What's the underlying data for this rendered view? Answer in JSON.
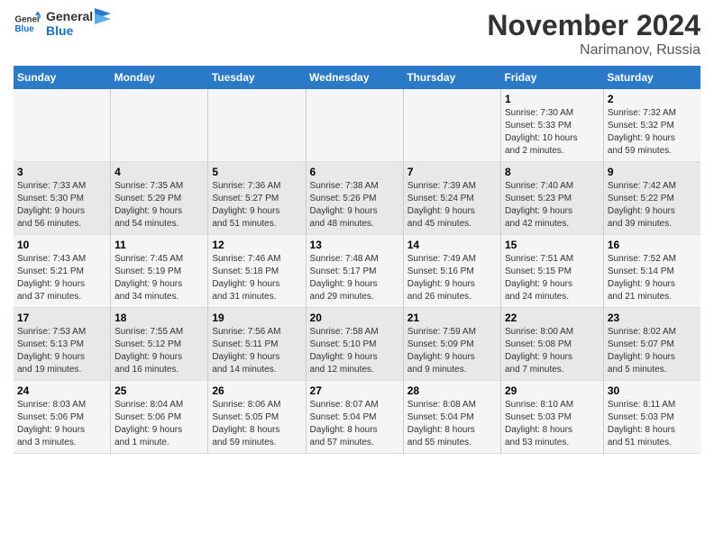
{
  "header": {
    "logo_general": "General",
    "logo_blue": "Blue",
    "title": "November 2024",
    "subtitle": "Narimanov, Russia"
  },
  "days_of_week": [
    "Sunday",
    "Monday",
    "Tuesday",
    "Wednesday",
    "Thursday",
    "Friday",
    "Saturday"
  ],
  "weeks": [
    {
      "days": [
        {
          "num": "",
          "info": ""
        },
        {
          "num": "",
          "info": ""
        },
        {
          "num": "",
          "info": ""
        },
        {
          "num": "",
          "info": ""
        },
        {
          "num": "",
          "info": ""
        },
        {
          "num": "1",
          "info": "Sunrise: 7:30 AM\nSunset: 5:33 PM\nDaylight: 10 hours\nand 2 minutes."
        },
        {
          "num": "2",
          "info": "Sunrise: 7:32 AM\nSunset: 5:32 PM\nDaylight: 9 hours\nand 59 minutes."
        }
      ]
    },
    {
      "days": [
        {
          "num": "3",
          "info": "Sunrise: 7:33 AM\nSunset: 5:30 PM\nDaylight: 9 hours\nand 56 minutes."
        },
        {
          "num": "4",
          "info": "Sunrise: 7:35 AM\nSunset: 5:29 PM\nDaylight: 9 hours\nand 54 minutes."
        },
        {
          "num": "5",
          "info": "Sunrise: 7:36 AM\nSunset: 5:27 PM\nDaylight: 9 hours\nand 51 minutes."
        },
        {
          "num": "6",
          "info": "Sunrise: 7:38 AM\nSunset: 5:26 PM\nDaylight: 9 hours\nand 48 minutes."
        },
        {
          "num": "7",
          "info": "Sunrise: 7:39 AM\nSunset: 5:24 PM\nDaylight: 9 hours\nand 45 minutes."
        },
        {
          "num": "8",
          "info": "Sunrise: 7:40 AM\nSunset: 5:23 PM\nDaylight: 9 hours\nand 42 minutes."
        },
        {
          "num": "9",
          "info": "Sunrise: 7:42 AM\nSunset: 5:22 PM\nDaylight: 9 hours\nand 39 minutes."
        }
      ]
    },
    {
      "days": [
        {
          "num": "10",
          "info": "Sunrise: 7:43 AM\nSunset: 5:21 PM\nDaylight: 9 hours\nand 37 minutes."
        },
        {
          "num": "11",
          "info": "Sunrise: 7:45 AM\nSunset: 5:19 PM\nDaylight: 9 hours\nand 34 minutes."
        },
        {
          "num": "12",
          "info": "Sunrise: 7:46 AM\nSunset: 5:18 PM\nDaylight: 9 hours\nand 31 minutes."
        },
        {
          "num": "13",
          "info": "Sunrise: 7:48 AM\nSunset: 5:17 PM\nDaylight: 9 hours\nand 29 minutes."
        },
        {
          "num": "14",
          "info": "Sunrise: 7:49 AM\nSunset: 5:16 PM\nDaylight: 9 hours\nand 26 minutes."
        },
        {
          "num": "15",
          "info": "Sunrise: 7:51 AM\nSunset: 5:15 PM\nDaylight: 9 hours\nand 24 minutes."
        },
        {
          "num": "16",
          "info": "Sunrise: 7:52 AM\nSunset: 5:14 PM\nDaylight: 9 hours\nand 21 minutes."
        }
      ]
    },
    {
      "days": [
        {
          "num": "17",
          "info": "Sunrise: 7:53 AM\nSunset: 5:13 PM\nDaylight: 9 hours\nand 19 minutes."
        },
        {
          "num": "18",
          "info": "Sunrise: 7:55 AM\nSunset: 5:12 PM\nDaylight: 9 hours\nand 16 minutes."
        },
        {
          "num": "19",
          "info": "Sunrise: 7:56 AM\nSunset: 5:11 PM\nDaylight: 9 hours\nand 14 minutes."
        },
        {
          "num": "20",
          "info": "Sunrise: 7:58 AM\nSunset: 5:10 PM\nDaylight: 9 hours\nand 12 minutes."
        },
        {
          "num": "21",
          "info": "Sunrise: 7:59 AM\nSunset: 5:09 PM\nDaylight: 9 hours\nand 9 minutes."
        },
        {
          "num": "22",
          "info": "Sunrise: 8:00 AM\nSunset: 5:08 PM\nDaylight: 9 hours\nand 7 minutes."
        },
        {
          "num": "23",
          "info": "Sunrise: 8:02 AM\nSunset: 5:07 PM\nDaylight: 9 hours\nand 5 minutes."
        }
      ]
    },
    {
      "days": [
        {
          "num": "24",
          "info": "Sunrise: 8:03 AM\nSunset: 5:06 PM\nDaylight: 9 hours\nand 3 minutes."
        },
        {
          "num": "25",
          "info": "Sunrise: 8:04 AM\nSunset: 5:06 PM\nDaylight: 9 hours\nand 1 minute."
        },
        {
          "num": "26",
          "info": "Sunrise: 8:06 AM\nSunset: 5:05 PM\nDaylight: 8 hours\nand 59 minutes."
        },
        {
          "num": "27",
          "info": "Sunrise: 8:07 AM\nSunset: 5:04 PM\nDaylight: 8 hours\nand 57 minutes."
        },
        {
          "num": "28",
          "info": "Sunrise: 8:08 AM\nSunset: 5:04 PM\nDaylight: 8 hours\nand 55 minutes."
        },
        {
          "num": "29",
          "info": "Sunrise: 8:10 AM\nSunset: 5:03 PM\nDaylight: 8 hours\nand 53 minutes."
        },
        {
          "num": "30",
          "info": "Sunrise: 8:11 AM\nSunset: 5:03 PM\nDaylight: 8 hours\nand 51 minutes."
        }
      ]
    }
  ]
}
